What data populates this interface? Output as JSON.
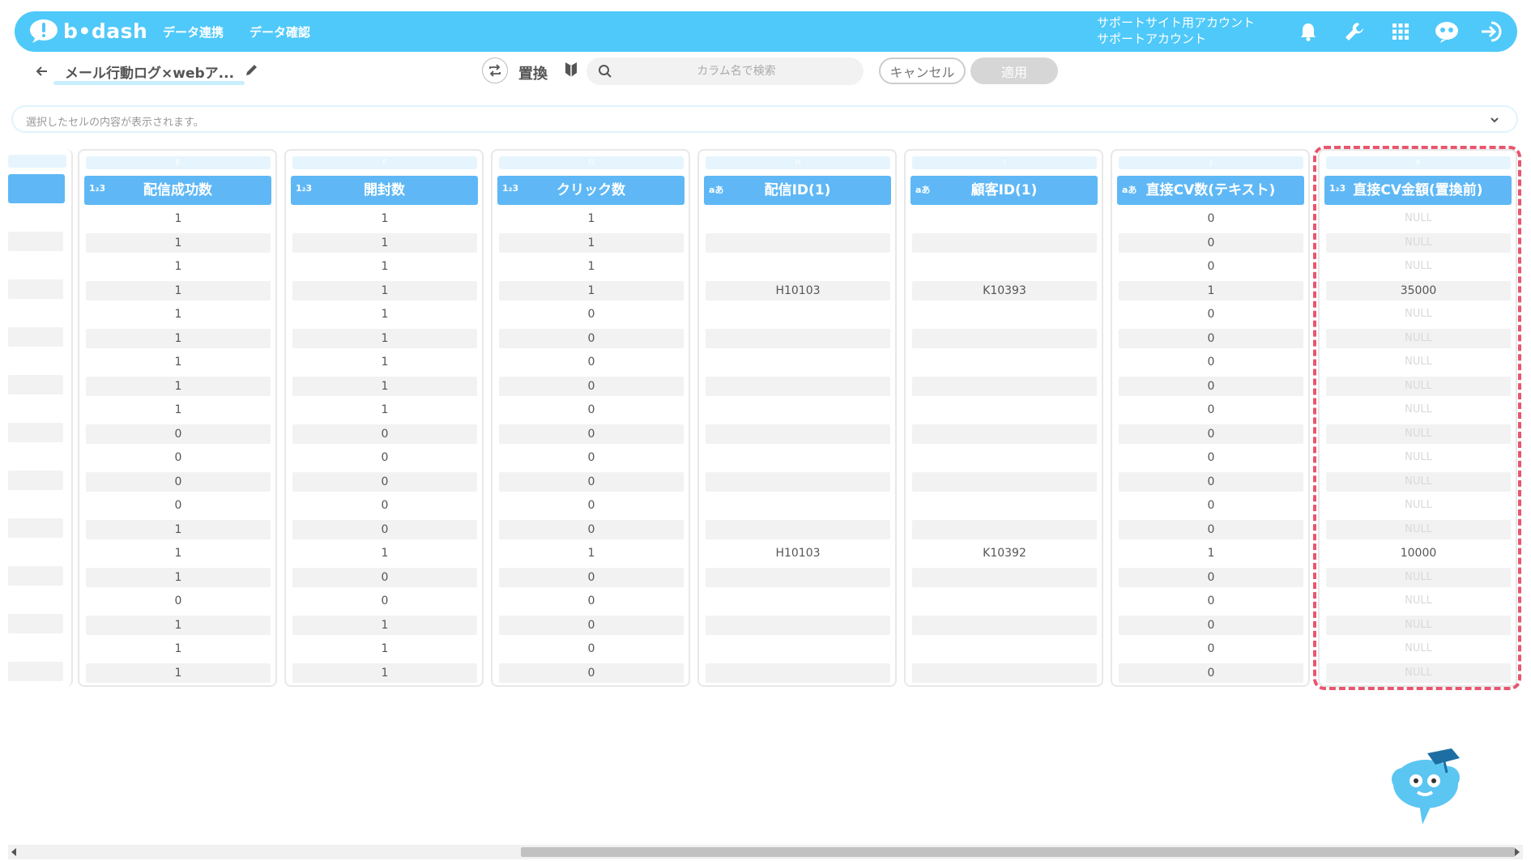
{
  "header": {
    "logo_text": "b•dash",
    "nav": [
      "データ連携",
      "データ確認"
    ],
    "account_line1": "サポートサイト用アカウント",
    "account_line2": "サポートアカウント",
    "icons": [
      "bell-icon",
      "wrench-icon",
      "grid-icon",
      "mascot-icon",
      "logout-icon"
    ],
    "color": "#4fc9f9"
  },
  "toolbar": {
    "sheet_title": "メール行動ログ×webア...",
    "replace_label": "置換",
    "search_placeholder": "カラム名で検索",
    "cancel_label": "キャンセル",
    "apply_label": "適用"
  },
  "preview": {
    "placeholder": "選択したセルの内容が表示されます。"
  },
  "grid": {
    "columns": [
      {
        "letter": "E",
        "type": "1₂3",
        "name": "配信成功数",
        "null": false,
        "values": [
          "1",
          "1",
          "1",
          "1",
          "1",
          "1",
          "1",
          "1",
          "1",
          "0",
          "0",
          "0",
          "0",
          "1",
          "1",
          "1",
          "0",
          "1",
          "1",
          "1"
        ]
      },
      {
        "letter": "F",
        "type": "1₂3",
        "name": "開封数",
        "null": false,
        "values": [
          "1",
          "1",
          "1",
          "1",
          "1",
          "1",
          "1",
          "1",
          "1",
          "0",
          "0",
          "0",
          "0",
          "0",
          "1",
          "0",
          "0",
          "1",
          "1",
          "1"
        ]
      },
      {
        "letter": "G",
        "type": "1₂3",
        "name": "クリック数",
        "null": false,
        "values": [
          "1",
          "1",
          "1",
          "1",
          "0",
          "0",
          "0",
          "0",
          "0",
          "0",
          "0",
          "0",
          "0",
          "0",
          "1",
          "0",
          "0",
          "0",
          "0",
          "0"
        ]
      },
      {
        "letter": "H",
        "type": "aあ",
        "name": "配信ID(1)",
        "null": false,
        "values": [
          "",
          "",
          "",
          "H10103",
          "",
          "",
          "",
          "",
          "",
          "",
          "",
          "",
          "",
          "",
          "H10103",
          "",
          "",
          "",
          "",
          ""
        ]
      },
      {
        "letter": "I",
        "type": "aあ",
        "name": "顧客ID(1)",
        "null": false,
        "values": [
          "",
          "",
          "",
          "K10393",
          "",
          "",
          "",
          "",
          "",
          "",
          "",
          "",
          "",
          "",
          "K10392",
          "",
          "",
          "",
          "",
          ""
        ]
      },
      {
        "letter": "J",
        "type": "aあ",
        "name": "直接CV数(テキスト)",
        "null": false,
        "values": [
          "0",
          "0",
          "0",
          "1",
          "0",
          "0",
          "0",
          "0",
          "0",
          "0",
          "0",
          "0",
          "0",
          "0",
          "1",
          "0",
          "0",
          "0",
          "0",
          "0"
        ]
      },
      {
        "letter": "K",
        "type": "1₂3",
        "name": "直接CV金額(置換前)",
        "null": true,
        "values": [
          "NULL",
          "NULL",
          "NULL",
          "35000",
          "NULL",
          "NULL",
          "NULL",
          "NULL",
          "NULL",
          "NULL",
          "NULL",
          "NULL",
          "NULL",
          "NULL",
          "10000",
          "NULL",
          "NULL",
          "NULL",
          "NULL",
          "NULL"
        ]
      }
    ]
  },
  "highlight_color": "#e8566e"
}
